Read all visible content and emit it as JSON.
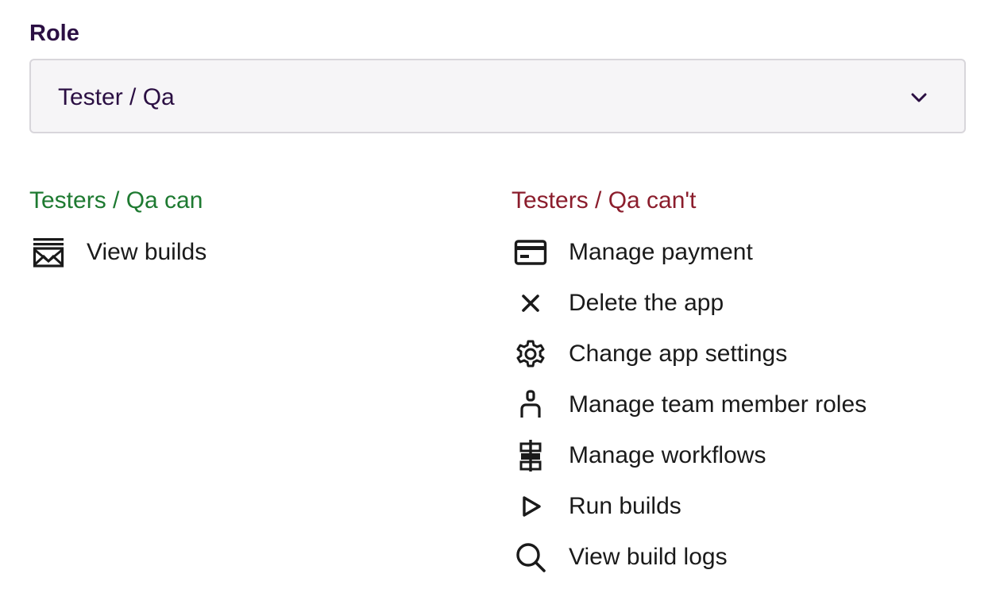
{
  "role": {
    "label": "Role",
    "selected": "Tester / Qa"
  },
  "can": {
    "heading": "Testers / Qa can",
    "items": [
      {
        "label": "View builds",
        "icon": "build-image-icon"
      }
    ]
  },
  "cant": {
    "heading": "Testers / Qa can't",
    "items": [
      {
        "label": "Manage payment",
        "icon": "credit-card-icon"
      },
      {
        "label": "Delete the app",
        "icon": "close-icon"
      },
      {
        "label": "Change app settings",
        "icon": "gear-icon"
      },
      {
        "label": "Manage team member roles",
        "icon": "person-icon"
      },
      {
        "label": "Manage workflows",
        "icon": "workflow-icon"
      },
      {
        "label": "Run builds",
        "icon": "play-icon"
      },
      {
        "label": "View build logs",
        "icon": "search-icon"
      }
    ]
  },
  "colors": {
    "title": "#2b0f43",
    "can": "#1e7a31",
    "cant": "#8b1d2c",
    "select_bg": "#f6f5f7",
    "select_border": "#d8d6db"
  }
}
